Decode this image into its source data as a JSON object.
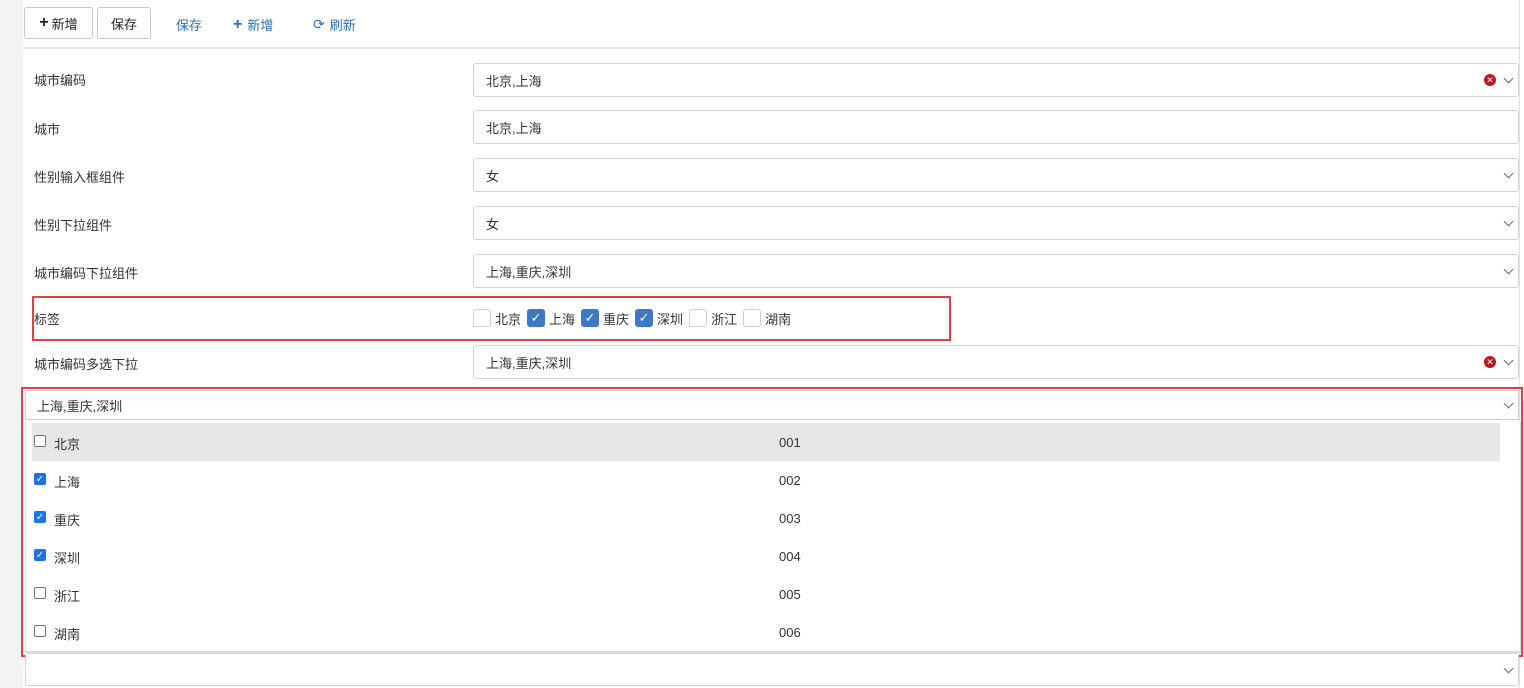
{
  "toolbar": {
    "add_button": "新增",
    "save_button": "保存",
    "save_link": "保存",
    "add_link": "新增",
    "refresh_link": "刷新"
  },
  "form": {
    "city_code_label": "城市编码",
    "city_code_value": "北京,上海",
    "city_label": "城市",
    "city_value": "北京,上海",
    "gender_input_label": "性别输入框组件",
    "gender_input_value": "女",
    "gender_select_label": "性别下拉组件",
    "gender_select_value": "女",
    "city_code_select_label": "城市编码下拉组件",
    "city_code_select_value": "上海,重庆,深圳",
    "tags_label": "标签",
    "tags": [
      {
        "label": "北京",
        "checked": false
      },
      {
        "label": "上海",
        "checked": true
      },
      {
        "label": "重庆",
        "checked": true
      },
      {
        "label": "深圳",
        "checked": true
      },
      {
        "label": "浙江",
        "checked": false
      },
      {
        "label": "湖南",
        "checked": false
      }
    ],
    "multi_select_label": "城市编码多选下拉",
    "multi_select_value": "上海,重庆,深圳"
  },
  "dropdown": {
    "value": "上海,重庆,深圳",
    "options": [
      {
        "label": "北京",
        "code": "001",
        "checked": false
      },
      {
        "label": "上海",
        "code": "002",
        "checked": true
      },
      {
        "label": "重庆",
        "code": "003",
        "checked": true
      },
      {
        "label": "深圳",
        "code": "004",
        "checked": true
      },
      {
        "label": "浙江",
        "code": "005",
        "checked": false
      },
      {
        "label": "湖南",
        "code": "006",
        "checked": false
      }
    ]
  },
  "colors": {
    "highlight": "#e34040",
    "checkbox_on": "#3c78c4",
    "link": "#2a6ebb"
  }
}
